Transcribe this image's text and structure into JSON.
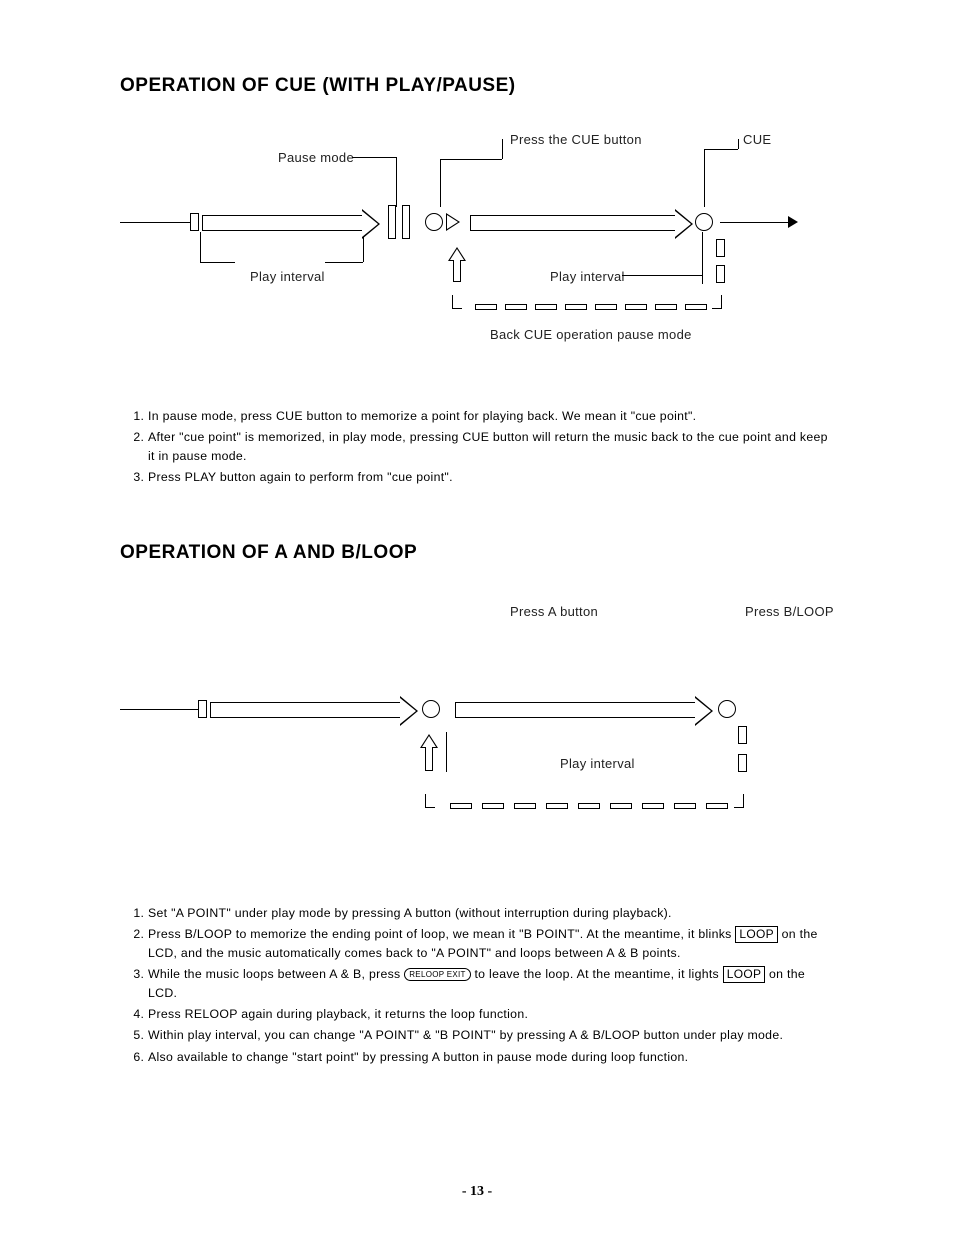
{
  "section1": {
    "title": "OPERATION OF CUE (WITH PLAY/PAUSE)",
    "diagram": {
      "press_cue": "Press the CUE button",
      "cue": "CUE",
      "pause_mode": "Pause mode",
      "play_interval_left": "Play interval",
      "play_interval_right": "Play interval",
      "back_cue": "Back CUE operation pause mode"
    },
    "steps": [
      "In pause mode, press CUE button to memorize a point for playing back. We mean it \"cue point\".",
      "After \"cue point\" is memorized, in play mode, pressing CUE button will return the music back to the cue point and keep it in pause mode.",
      "Press PLAY button again to perform from \"cue point\"."
    ]
  },
  "section2": {
    "title": "OPERATION OF A AND B/LOOP",
    "diagram": {
      "press_a": "Press A button",
      "press_bloop": "Press B/LOOP",
      "play_interval": "Play interval"
    },
    "steps_pre": "Set \"A POINT\" under play mode by pressing A button (without interruption during playback).",
    "step2_a": "Press B/LOOP to memorize the ending point of loop, we mean it \"B POINT\". At the meantime, it blinks ",
    "step2_b": " on the LCD, and the music automatically comes back to \"A POINT\" and loops between A & B points.",
    "step3_a": "While the music loops between A & B, press ",
    "step3_b": " to leave the loop. At the meantime, it lights ",
    "step3_c": " on the LCD.",
    "step4": "Press RELOOP again during playback, it returns the loop function.",
    "step5": "Within play interval, you can change \"A POINT\" & \"B POINT\" by pressing A & B/LOOP button under play mode.",
    "step6": "Also available to change \"start point\" by pressing A button in pause mode during loop function.",
    "loop_label": "LOOP",
    "reloop_btn": "RELOOP\nEXIT"
  },
  "page_number": "- 13 -"
}
